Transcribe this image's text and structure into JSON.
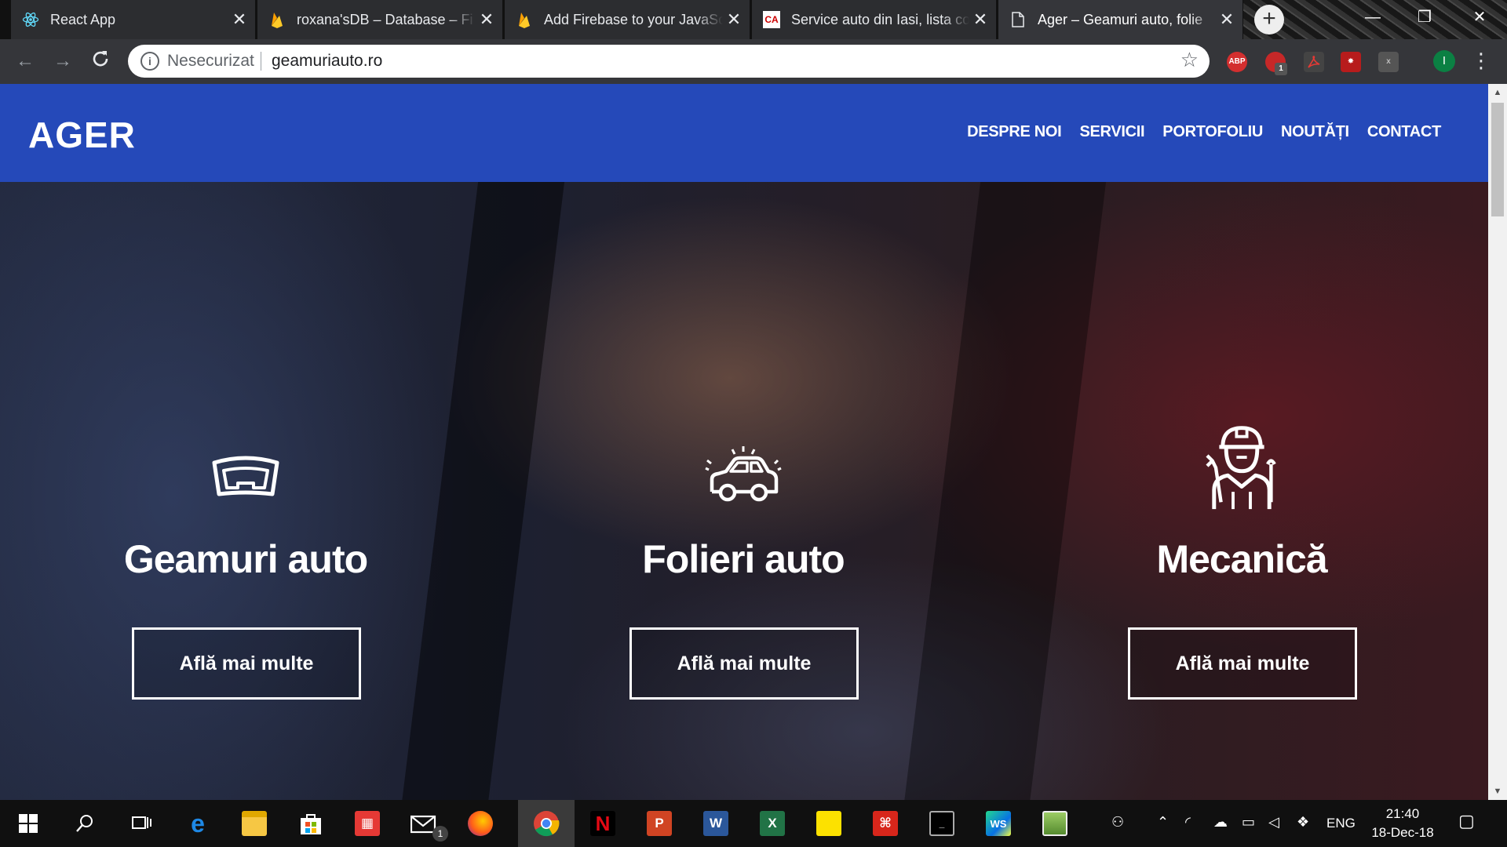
{
  "browser": {
    "tabs": [
      {
        "title": "React App",
        "favicon": "react-icon",
        "active": false
      },
      {
        "title": "roxana'sDB – Database – Fi",
        "favicon": "firebase-icon",
        "active": false
      },
      {
        "title": "Add Firebase to your JavaSc",
        "favicon": "firebase-icon",
        "active": false
      },
      {
        "title": "Service auto din Iasi, lista co",
        "favicon": "ca-icon",
        "active": false
      },
      {
        "title": "Ager – Geamuri auto, folie",
        "favicon": "page-icon",
        "active": true
      }
    ],
    "security_label": "Nesecurizat",
    "url": "geamuriauto.ro",
    "extensions": [
      "ABP",
      "1"
    ],
    "profile_initial": "I"
  },
  "site": {
    "logo": "AGER",
    "nav": [
      "DESPRE NOI",
      "SERVICII",
      "PORTOFOLIU",
      "NOUTĂȚI",
      "CONTACT"
    ],
    "header_color": "#2549b9",
    "services": [
      {
        "icon": "windshield-icon",
        "title": "Geamuri auto",
        "button": "Află mai multe"
      },
      {
        "icon": "car-icon",
        "title": "Folieri auto",
        "button": "Află mai multe"
      },
      {
        "icon": "mechanic-icon",
        "title": "Mecanică",
        "button": "Află mai multe"
      }
    ]
  },
  "taskbar": {
    "apps": [
      "start-icon",
      "search-icon",
      "task-view-icon",
      "edge-icon",
      "file-explorer-icon",
      "store-icon",
      "gift-icon",
      "mail-icon",
      "firefox-icon",
      "chrome-icon",
      "netflix-icon",
      "powerpoint-icon",
      "word-icon",
      "excel-icon",
      "sticky-notes-icon",
      "acrobat-icon",
      "terminal-icon",
      "webstorm-icon",
      "image-editor-icon"
    ],
    "mail_badge": "1",
    "language": "ENG",
    "time": "21:40",
    "date": "18-Dec-18"
  }
}
